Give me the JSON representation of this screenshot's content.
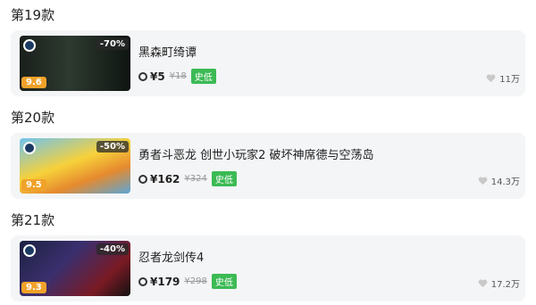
{
  "sections": [
    {
      "title": "第19款",
      "game": {
        "title": "黑森町绮谭",
        "price": "¥5",
        "old_price": "¥18",
        "tag": "史低",
        "discount": "-70%",
        "score": "9.6",
        "likes": "11万"
      }
    },
    {
      "title": "第20款",
      "game": {
        "title": "勇者斗恶龙 创世小玩家2 破坏神席德与空荡岛",
        "price": "¥162",
        "old_price": "¥324",
        "tag": "史低",
        "discount": "-50%",
        "score": "9.5",
        "likes": "14.3万"
      }
    },
    {
      "title": "第21款",
      "game": {
        "title": "忍者龙剑传4",
        "price": "¥179",
        "old_price": "¥298",
        "tag": "史低",
        "discount": "-40%",
        "score": "9.3",
        "likes": "17.2万"
      }
    }
  ],
  "icons": {
    "platform": "steam-icon",
    "price": "price-tag-icon",
    "like": "heart-icon"
  },
  "colors": {
    "tag_low": "#3cba54",
    "score_badge": "#f0a22a",
    "card_bg": "#f4f5f7"
  }
}
